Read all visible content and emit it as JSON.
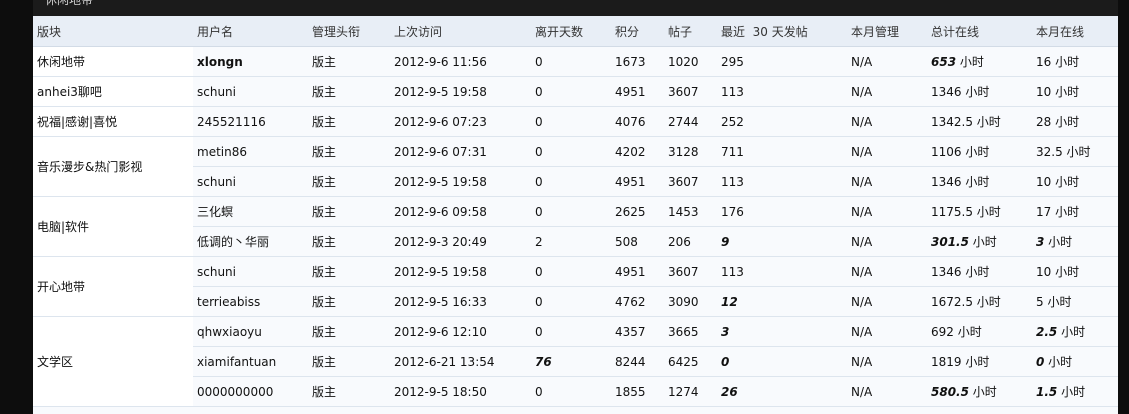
{
  "header_tab": "休闲地带",
  "columns": [
    "版块",
    "用户名",
    "管理头衔",
    "上次访问",
    "离开天数",
    "积分",
    "帖子",
    "最近  30 天发帖",
    "本月管理",
    "总计在线",
    "本月在线"
  ],
  "rows": [
    {
      "board": "休闲地带",
      "rowspan": 1,
      "user": "xlongn",
      "title": "版主",
      "last": "2012-9-6 11:56",
      "away": "0",
      "score": "1673",
      "posts": "1020",
      "recent": "295",
      "month_manage": "N/A",
      "total_online": "653",
      "total_unit": " 小时",
      "month_online": "16 小时",
      "user_bold": true,
      "total_bold": true
    },
    {
      "board": "anhei3聊吧",
      "rowspan": 1,
      "user": "schuni",
      "title": "版主",
      "last": "2012-9-5 19:58",
      "away": "0",
      "score": "4951",
      "posts": "3607",
      "recent": "113",
      "month_manage": "N/A",
      "total_online": "1346 小时",
      "month_online": "10 小时"
    },
    {
      "board": "祝福|感谢|喜悦",
      "rowspan": 1,
      "user": "245521116",
      "title": "版主",
      "last": "2012-9-6 07:23",
      "away": "0",
      "score": "4076",
      "posts": "2744",
      "recent": "252",
      "month_manage": "N/A",
      "total_online": "1342.5 小时",
      "month_online": "28 小时"
    },
    {
      "board": "音乐漫步&热门影视",
      "rowspan": 2,
      "user": "metin86",
      "title": "版主",
      "last": "2012-9-6 07:31",
      "away": "0",
      "score": "4202",
      "posts": "3128",
      "recent": "711",
      "month_manage": "N/A",
      "total_online": "1106 小时",
      "month_online": "32.5 小时"
    },
    {
      "user": "schuni",
      "title": "版主",
      "last": "2012-9-5 19:58",
      "away": "0",
      "score": "4951",
      "posts": "3607",
      "recent": "113",
      "month_manage": "N/A",
      "total_online": "1346 小时",
      "month_online": "10 小时"
    },
    {
      "board": "电脑|软件",
      "rowspan": 2,
      "user": "三化螟",
      "title": "版主",
      "last": "2012-9-6 09:58",
      "away": "0",
      "score": "2625",
      "posts": "1453",
      "recent": "176",
      "month_manage": "N/A",
      "total_online": "1175.5 小时",
      "month_online": "17 小时"
    },
    {
      "user": "低调的丶华丽",
      "title": "版主",
      "last": "2012-9-3 20:49",
      "away": "2",
      "score": "508",
      "posts": "206",
      "recent": "9",
      "month_manage": "N/A",
      "total_online": "301.5",
      "total_unit": " 小时",
      "month_online": "3",
      "month_unit": " 小时",
      "recent_bold": true,
      "total_bold": true,
      "month_bold": true
    },
    {
      "board": "开心地带",
      "rowspan": 2,
      "user": "schuni",
      "title": "版主",
      "last": "2012-9-5 19:58",
      "away": "0",
      "score": "4951",
      "posts": "3607",
      "recent": "113",
      "month_manage": "N/A",
      "total_online": "1346 小时",
      "month_online": "10 小时"
    },
    {
      "user": "terrieabiss",
      "title": "版主",
      "last": "2012-9-5 16:33",
      "away": "0",
      "score": "4762",
      "posts": "3090",
      "recent": "12",
      "month_manage": "N/A",
      "total_online": "1672.5 小时",
      "month_online": "5 小时",
      "recent_bold": true
    },
    {
      "board": "文学区",
      "rowspan": 3,
      "user": "qhwxiaoyu",
      "title": "版主",
      "last": "2012-9-6 12:10",
      "away": "0",
      "score": "4357",
      "posts": "3665",
      "recent": "3",
      "month_manage": "N/A",
      "total_online": "692 小时",
      "month_online": "2.5",
      "month_unit": " 小时",
      "recent_bold": true,
      "month_bold": true
    },
    {
      "user": "xiamifantuan",
      "title": "版主",
      "last": "2012-6-21 13:54",
      "away": "76",
      "score": "8244",
      "posts": "6425",
      "recent": "0",
      "month_manage": "N/A",
      "total_online": "1819 小时",
      "month_online": "0",
      "month_unit": " 小时",
      "away_bold": true,
      "recent_bold": true,
      "month_bold": true
    },
    {
      "user": "0000000000",
      "title": "版主",
      "last": "2012-9-5 18:50",
      "away": "0",
      "score": "1855",
      "posts": "1274",
      "recent": "26",
      "month_manage": "N/A",
      "total_online": "580.5",
      "total_unit": " 小时",
      "month_online": "1.5",
      "month_unit": " 小时",
      "recent_bold": true,
      "total_bold": true,
      "month_bold": true
    }
  ]
}
